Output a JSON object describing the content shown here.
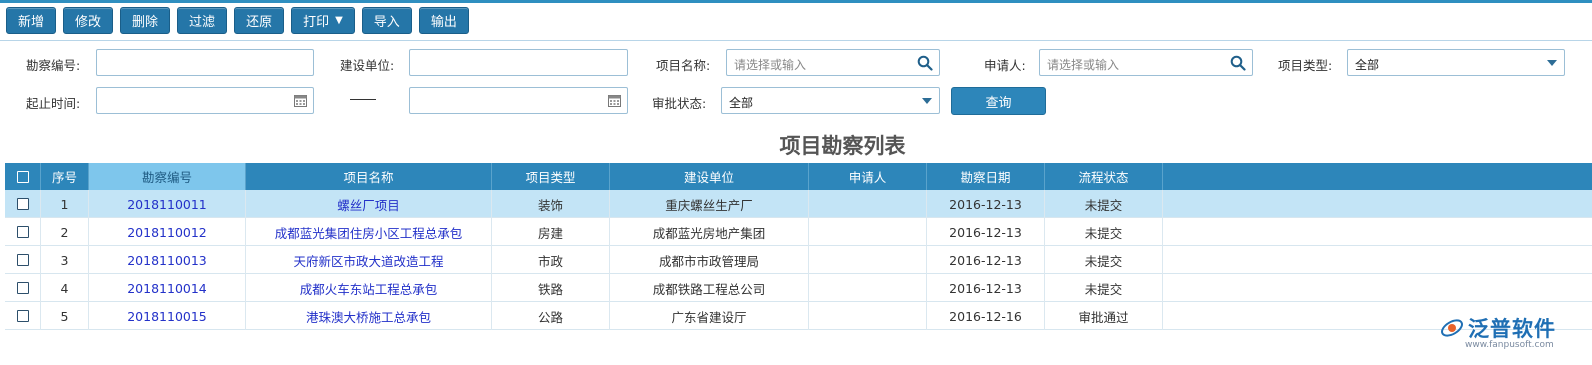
{
  "toolbar": {
    "add": "新增",
    "edit": "修改",
    "delete": "删除",
    "filter": "过滤",
    "restore": "还原",
    "print": "打印",
    "import": "导入",
    "export": "输出"
  },
  "filters": {
    "survey_no_label": "勘察编号:",
    "survey_no_value": "",
    "builder_label": "建设单位:",
    "builder_value": "",
    "project_name_label": "项目名称:",
    "project_name_placeholder": "请选择或输入",
    "applicant_label": "申请人:",
    "applicant_placeholder": "请选择或输入",
    "project_type_label": "项目类型:",
    "project_type_value": "全部",
    "period_label": "起止时间:",
    "period_start": "",
    "period_end": "",
    "approval_label": "审批状态:",
    "approval_value": "全部",
    "query_button": "查询"
  },
  "title": "项目勘察列表",
  "table": {
    "columns": [
      "序号",
      "勘察编号",
      "项目名称",
      "项目类型",
      "建设单位",
      "申请人",
      "勘察日期",
      "流程状态"
    ],
    "rows": [
      {
        "no": "1",
        "code": "2018110011",
        "name": "螺丝厂项目",
        "type": "装饰",
        "builder": "重庆螺丝生产厂",
        "applicant": "",
        "date": "2016-12-13",
        "status": "未提交"
      },
      {
        "no": "2",
        "code": "2018110012",
        "name": "成都蓝光集团住房小区工程总承包",
        "type": "房建",
        "builder": "成都蓝光房地产集团",
        "applicant": "",
        "date": "2016-12-13",
        "status": "未提交"
      },
      {
        "no": "3",
        "code": "2018110013",
        "name": "天府新区市政大道改造工程",
        "type": "市政",
        "builder": "成都市市政管理局",
        "applicant": "",
        "date": "2016-12-13",
        "status": "未提交"
      },
      {
        "no": "4",
        "code": "2018110014",
        "name": "成都火车东站工程总承包",
        "type": "铁路",
        "builder": "成都铁路工程总公司",
        "applicant": "",
        "date": "2016-12-13",
        "status": "未提交"
      },
      {
        "no": "5",
        "code": "2018110015",
        "name": "港珠澳大桥施工总承包",
        "type": "公路",
        "builder": "广东省建设厅",
        "applicant": "",
        "date": "2016-12-16",
        "status": "审批通过"
      }
    ]
  },
  "logo": {
    "text": "泛普软件",
    "url": "www.fanpusoft.com"
  },
  "colors": {
    "primary": "#2576a8",
    "header": "#2d86ba",
    "selected_row": "#c3e4f6",
    "link": "#2331c9"
  }
}
